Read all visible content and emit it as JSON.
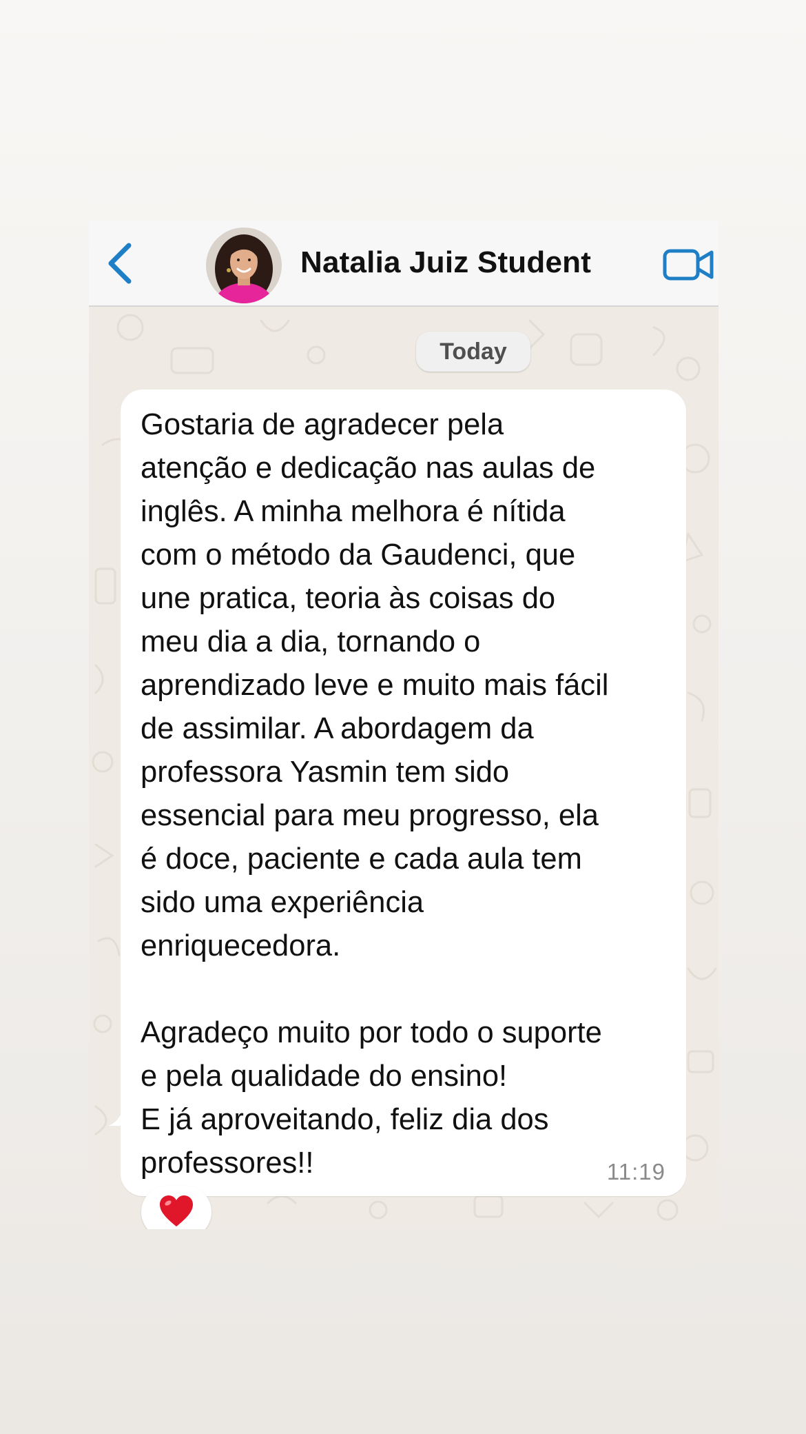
{
  "header": {
    "contact_name": "Natalia Juiz Student",
    "back_icon": "chevron-left-icon",
    "video_icon": "video-camera-icon",
    "accent_color": "#1f7fc6"
  },
  "chat": {
    "date_label": "Today",
    "messages": [
      {
        "text": "Gostaria de agradecer pela\natenção e dedicação nas aulas de\ninglês. A minha melhora é nítida\ncom o método da Gaudenci, que\nune pratica, teoria às coisas do\nmeu dia a dia, tornando o\naprendizado leve e muito mais fácil\nde assimilar. A abordagem da\nprofessora Yasmin tem sido\nessencial para meu progresso, ela\né doce, paciente e cada aula tem\nsido uma experiência\nenriquecedora.\n\nAgradeço muito por todo o suporte\ne pela qualidade do ensino!\nE já aproveitando, feliz dia dos\nprofessores!!",
        "time": "11:19",
        "reaction": "heart-icon",
        "reaction_color": "#e0172b"
      }
    ]
  }
}
